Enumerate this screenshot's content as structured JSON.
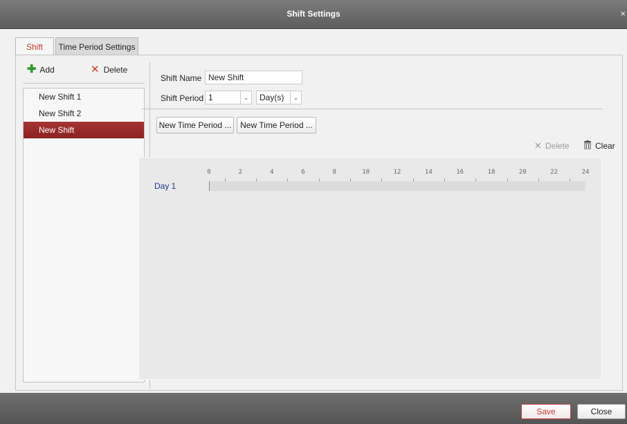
{
  "window": {
    "title": "Shift Settings",
    "close_glyph": "×"
  },
  "tabs": [
    {
      "label": "Shift",
      "active": true
    },
    {
      "label": "Time Period Settings",
      "active": false
    }
  ],
  "left_panel": {
    "add_label": "Add",
    "add_icon": "plus-icon",
    "delete_label": "Delete",
    "delete_icon": "x-icon",
    "shifts": [
      {
        "label": "New Shift 1",
        "selected": false
      },
      {
        "label": "New Shift 2",
        "selected": false
      },
      {
        "label": "New Shift",
        "selected": true
      }
    ]
  },
  "form": {
    "shift_name_label": "Shift Name",
    "shift_name_value": "New Shift",
    "shift_period_label": "Shift Period",
    "shift_period_value": "1",
    "shift_period_unit": "Day(s)"
  },
  "period_buttons": [
    {
      "label": "New Time Period ..."
    },
    {
      "label": "New Time Period ..."
    }
  ],
  "timeline_actions": {
    "delete_label": "Delete",
    "delete_icon": "x-icon",
    "clear_label": "Clear",
    "clear_icon": "trash-icon"
  },
  "timeline": {
    "day_label": "Day 1",
    "hour_labels": [
      "0",
      "2",
      "4",
      "6",
      "8",
      "10",
      "12",
      "14",
      "16",
      "18",
      "20",
      "22",
      "24"
    ]
  },
  "footer": {
    "save_label": "Save",
    "close_label": "Close"
  },
  "colors": {
    "accent": "#c0392b",
    "selected_row": "#962828",
    "title_bar": "#6b6b6b"
  }
}
